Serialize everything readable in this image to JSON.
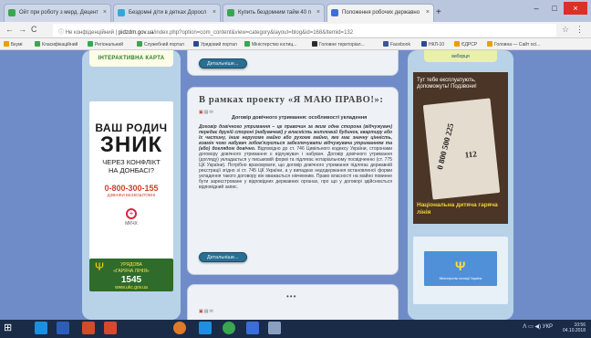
{
  "browser": {
    "tabs": [
      {
        "label": "Ойт при роботу з мерд. Децент",
        "color": "#3aa650"
      },
      {
        "label": "Бездомні діти в детках Доросл",
        "color": "#37a6d8"
      },
      {
        "label": "Купить бездомним тайм 40 п",
        "color": "#3aa650"
      },
      {
        "label": "Положення робочих державно",
        "color": "#3b6ee0",
        "active": true
      }
    ],
    "new_tab": "+",
    "window_buttons": [
      "–",
      "□",
      "×"
    ],
    "nav": {
      "back": "←",
      "forward": "→",
      "reload": "C",
      "info": "ⓘ"
    },
    "url_prefix": "Не конфіденційний",
    "url_domain": "pidzdm.gov.ua",
    "url_path": "/index.php?option=com_content&view=category&layout=blog&id=168&Itemid=132",
    "star": "☆",
    "menu": "⋮",
    "bookmarks": [
      {
        "label": "Бкумі",
        "color": "#e8a000"
      },
      {
        "label": "Класифікаційний",
        "color": "#3aa650"
      },
      {
        "label": "Регіональний",
        "color": "#3aa650"
      },
      {
        "label": "Служебний портал",
        "color": "#3aa650"
      },
      {
        "label": "Урядовий портал",
        "color": "#2a4b8d"
      },
      {
        "label": "Міністерство юстиц...",
        "color": "#3aa650"
      },
      {
        "label": "Головне територіал...",
        "color": "#2b2b2b"
      },
      {
        "label": "Facebook",
        "color": "#3b5998"
      },
      {
        "label": "НКЛ-10",
        "color": "#2a4b8d"
      },
      {
        "label": "ЄДРСР",
        "color": "#e8a000"
      },
      {
        "label": "Головна — Сайт осі...",
        "color": "#e8a000"
      }
    ]
  },
  "left": {
    "map_button": "ІНТЕРАКТИВНА КАРТА",
    "banner": {
      "line1": "ВАШ РОДИЧ",
      "line2": "ЗНИК",
      "line3": "ЧЕРЕЗ КОНФЛІКТ",
      "line4": "НА ДОНБАСІ?",
      "phone": "0-800-300-155",
      "phone_note": "ДЗВІНКИ БЕЗКОШТОВНІ",
      "org": "МКЧХ"
    },
    "hotline": {
      "line1": "УРЯДОВА",
      "line2": "«ГАРЯЧА ЛІНІЯ»",
      "number": "1545",
      "site": "www.ukc.gov.ua"
    }
  },
  "center": {
    "more_label": "Детальніше...",
    "article_title": "В рамках проекту «Я МАЮ ПРАВО!»:",
    "article_subtitle": "Договір довічного утримання: особливості укладення",
    "article_lead": "Договір довічного утримання – це правочин за яким одна сторона (відчужувач) передає другій стороні (набувачеві) у власність житловий будинок, квартиру або їх частину, інше нерухоме майно або рухоме майно, яке має значну цінність, взамін чого набувач зобов'язується забезпечувати відчужувача утриманням та (або) доглядом довічно.",
    "article_body": "Відповідно до ст. 746 Цивільного кодексу України, сторонами договору довічного утримання є відчужувач і набувач. Договір довічного утримання (догляду) укладається у письмовій формі та підлягає нотаріальному посвідченню (ст. 775 ЦК України). Потрібно враховувати, що договір довічного утримання підлягає державній реєстрації згідно зі ст. 745 ЦК України, а у випадках недодержання встановленої форми укладення такого договору він вважається нікчемним. Право власності на майно повинне бути зареєстроване у відповідних державних органах, про що у договорі здійснюється відповідний запис.",
    "more_label_2": "Детальніше...",
    "next_dots": "•••"
  },
  "right": {
    "top_button": "виборця",
    "card": {
      "caption": "Тут тебе експлуатують, допоможуть! Подзвони!",
      "paper_text": "0 800 500 225",
      "paper_code": "112",
      "footer": "Національна дитяча гаряча лінія"
    },
    "blue_sign": "Ψ",
    "blue_caption": "Міністерство юстиції України"
  },
  "taskbar": {
    "start": "⊞",
    "apps": [
      "#1d8fe0",
      "#2b5fb7",
      "#d44a2a",
      "#d44a2a",
      "#e07a2a",
      "#1d8fe0",
      "#3aa650",
      "#3a6ed8",
      "#8aa0c0"
    ],
    "time": "10:56",
    "date": "04.10.2018",
    "tray": "ᐱ ▭ ◀) УКР"
  },
  "colors": {
    "page_bg": "#6f8cc9",
    "column_bg": "#b8d2e8",
    "button_blue": "#2a6e92"
  }
}
